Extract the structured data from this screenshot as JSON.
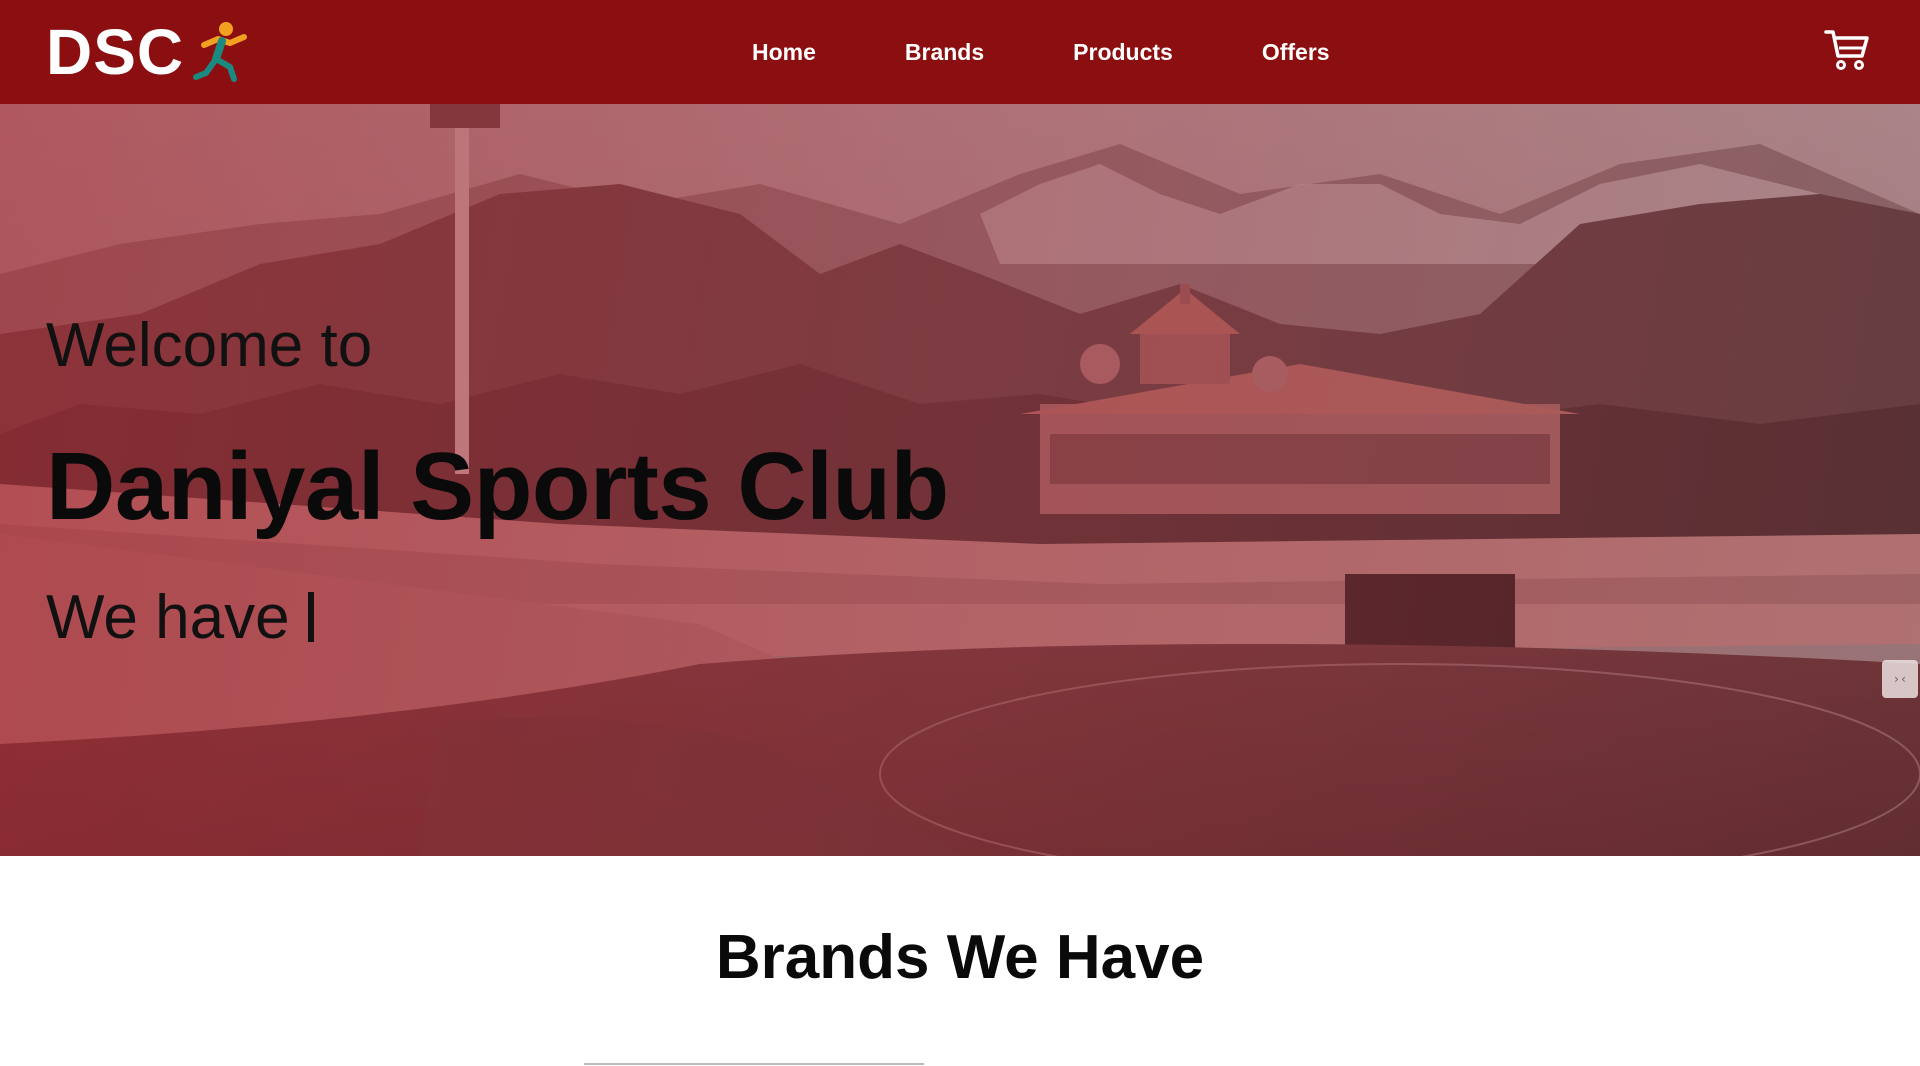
{
  "header": {
    "logo_text": "DSC",
    "nav": [
      {
        "label": "Home"
      },
      {
        "label": "Brands"
      },
      {
        "label": "Products"
      },
      {
        "label": "Offers"
      }
    ],
    "cart_icon": "cart-icon",
    "background": "#8b0e10"
  },
  "hero": {
    "welcome": "Welcome to",
    "title": "Daniyal Sports Club",
    "subtitle": "We have",
    "widget_text": "›‹"
  },
  "brands": {
    "title": "Brands We Have"
  },
  "colors": {
    "header_bg": "#8b0e10",
    "hero_tint": "#a82832",
    "runner_orange": "#f2a020",
    "runner_teal": "#1a8a80"
  }
}
